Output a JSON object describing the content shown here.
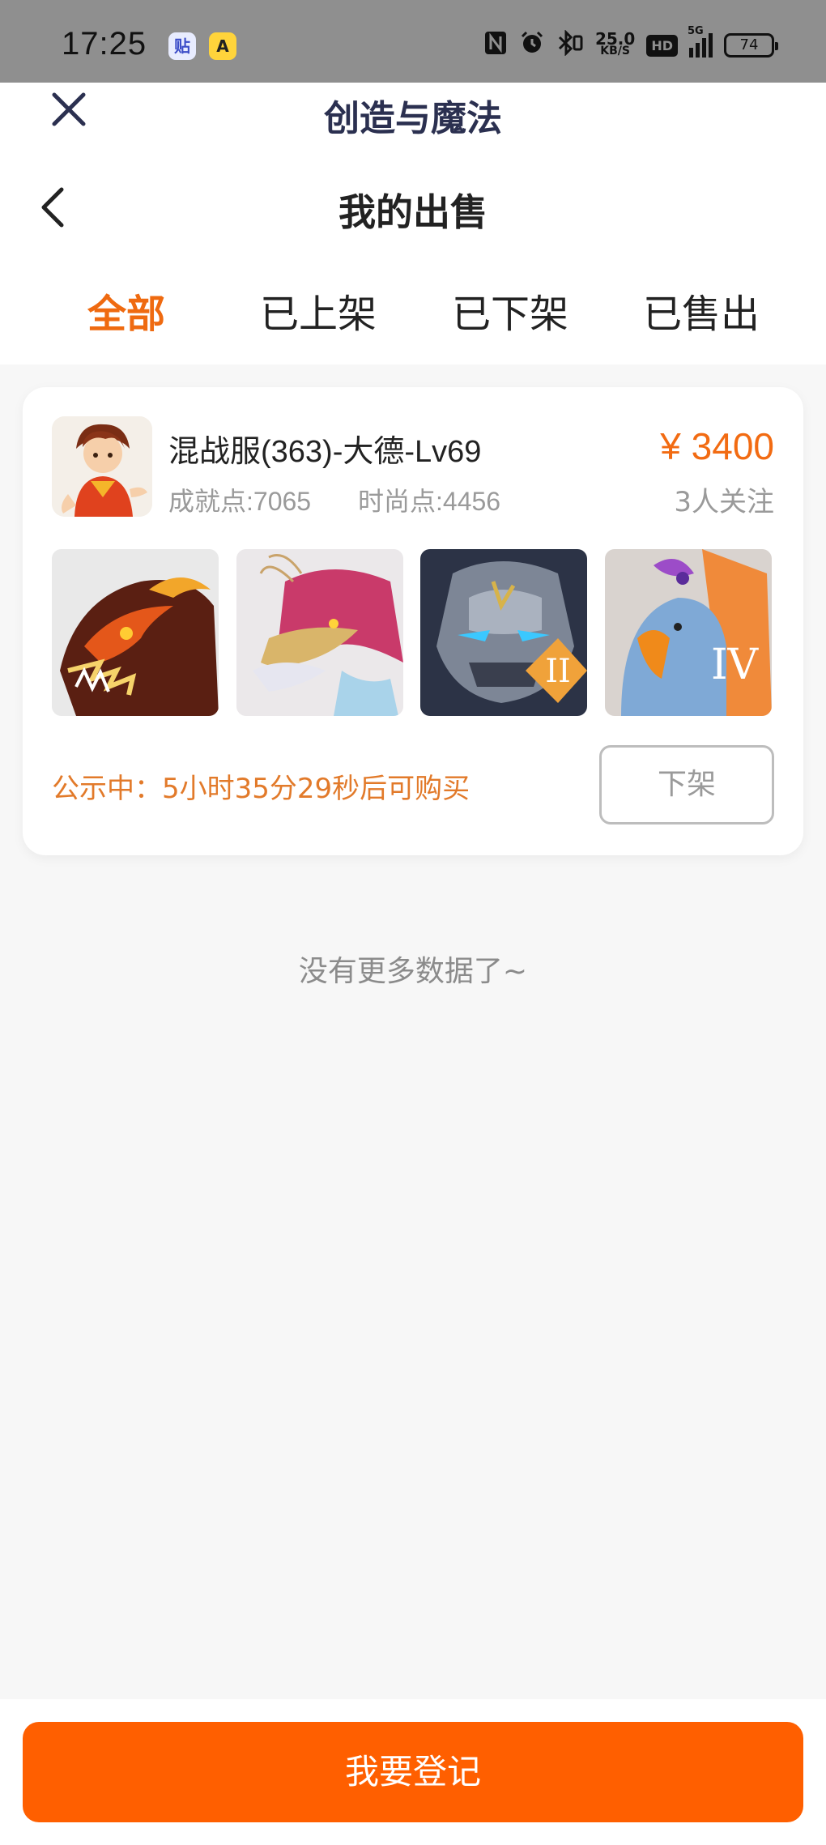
{
  "status_bar": {
    "time": "17:25",
    "apps": [
      "贴",
      "A"
    ],
    "network_speed_value": "25.0",
    "network_speed_unit": "KB/S",
    "hd_label": "HD",
    "signal_label": "5G",
    "battery": "74",
    "icons": [
      "nfc-icon",
      "alarm-icon",
      "bluetooth-icon",
      "signal-icon",
      "battery-icon"
    ]
  },
  "header": {
    "app_title": "创造与魔法",
    "page_title": "我的出售"
  },
  "tabs": [
    {
      "label": "全部",
      "active": true
    },
    {
      "label": "已上架",
      "active": false
    },
    {
      "label": "已下架",
      "active": false
    },
    {
      "label": "已售出",
      "active": false
    }
  ],
  "listing": {
    "title": "混战服(363)-大德-Lv69",
    "achievement": "成就点:7065",
    "fashion": "时尚点:4456",
    "price": "¥ 3400",
    "followers": "3人关注",
    "pets": [
      {
        "name": "fire-dragon-pet-image",
        "badge": ""
      },
      {
        "name": "eastern-dragon-pet-image",
        "badge": ""
      },
      {
        "name": "stone-golem-pet-image",
        "badge": "II"
      },
      {
        "name": "griffin-pet-image",
        "badge": "IV"
      }
    ],
    "notice": "公示中：5小时35分29秒后可购买",
    "delist_label": "下架"
  },
  "no_more_text": "没有更多数据了~",
  "register_label": "我要登记",
  "colors": {
    "accent": "#f26b12",
    "primary_button": "#ff5f00",
    "status_bar": "#8f8f8f",
    "background": "#f7f7f7"
  }
}
